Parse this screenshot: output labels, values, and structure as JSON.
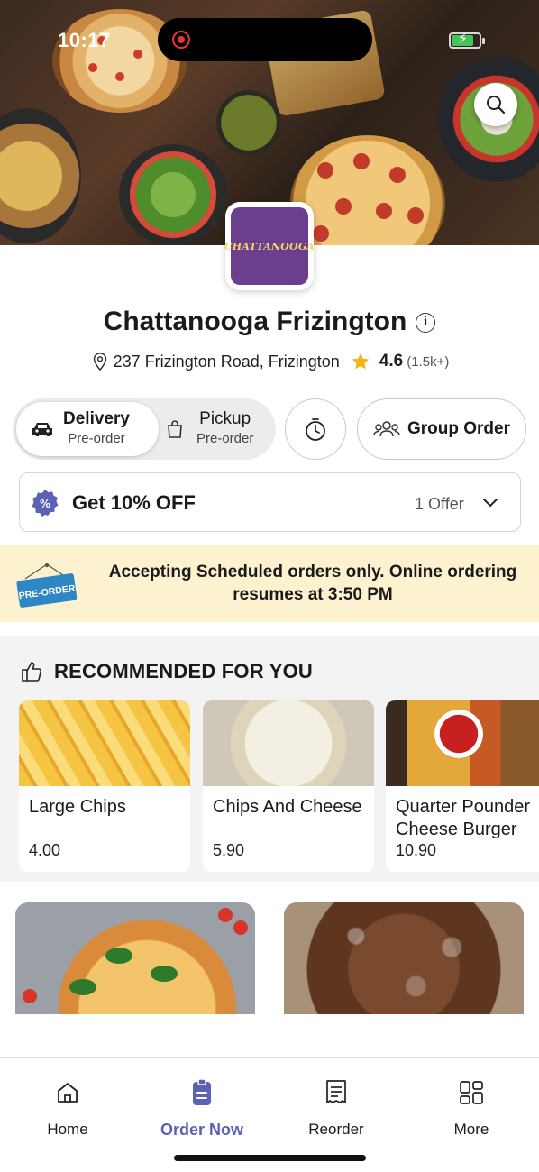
{
  "status_bar": {
    "time": "10:17"
  },
  "restaurant": {
    "logo_text": "CHATTANOOGA",
    "name": "Chattanooga Frizington",
    "address": "237 Frizington Road, Frizington",
    "rating": "4.6",
    "rating_count": "(1.5k+)"
  },
  "mode": {
    "delivery_label": "Delivery",
    "delivery_sub": "Pre-order",
    "pickup_label": "Pickup",
    "pickup_sub": "Pre-order",
    "selected": "Delivery"
  },
  "group_order_label": "Group Order",
  "offer": {
    "title": "Get 10% OFF",
    "count_text": "1 Offer"
  },
  "banner": {
    "sign_text": "PRE-ORDER",
    "message": "Accepting Scheduled orders only. Online ordering resumes at 3:50 PM"
  },
  "recommended": {
    "heading": "RECOMMENDED FOR YOU",
    "items": [
      {
        "name": "Large Chips",
        "price": "4.00"
      },
      {
        "name": "Chips And Cheese",
        "price": "5.90"
      },
      {
        "name": "Quarter Pounder Cheese Burger",
        "price": "10.90"
      }
    ]
  },
  "tabs": [
    {
      "label": "Home",
      "icon": "home-icon"
    },
    {
      "label": "Order Now",
      "icon": "order-icon"
    },
    {
      "label": "Reorder",
      "icon": "receipt-icon"
    },
    {
      "label": "More",
      "icon": "grid-icon"
    }
  ],
  "colors": {
    "accent": "#5b62b5",
    "banner_bg": "#fcf2cf",
    "star": "#f2b31b",
    "logo_bg": "#6a3f8e",
    "offer_badge": "#5b62b5",
    "preorder_sign": "#2f86c4"
  }
}
